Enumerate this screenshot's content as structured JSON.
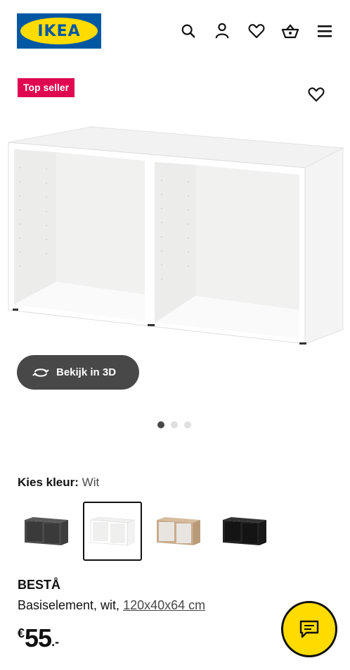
{
  "header": {
    "logo_text": "IKEA",
    "icons": [
      "search-icon",
      "account-icon",
      "favourites-icon",
      "cart-icon",
      "menu-icon"
    ]
  },
  "hero": {
    "badge": "Top seller",
    "view_3d_label": "Bekijk in 3D",
    "carousel": {
      "count": 3,
      "active_index": 0
    }
  },
  "color_picker": {
    "label": "Kies kleur:",
    "value": "Wit",
    "options": [
      {
        "color": "#4b4b4b",
        "name": "dark-grey"
      },
      {
        "color": "#ffffff",
        "name": "white",
        "selected": true
      },
      {
        "color": "#c9ab8b",
        "name": "oak-effect"
      },
      {
        "color": "#222222",
        "name": "black-brown"
      }
    ]
  },
  "product": {
    "name": "BESTÅ",
    "description": "Basiselement, wit,",
    "dimensions": "120x40x64 cm",
    "price_currency": "€",
    "price_amount": "55",
    "price_decimals": ".-"
  },
  "colors": {
    "ikea_blue": "#0058a3",
    "ikea_yellow": "#ffdb00",
    "badge_red": "#e00751",
    "dark_button": "#484848"
  }
}
